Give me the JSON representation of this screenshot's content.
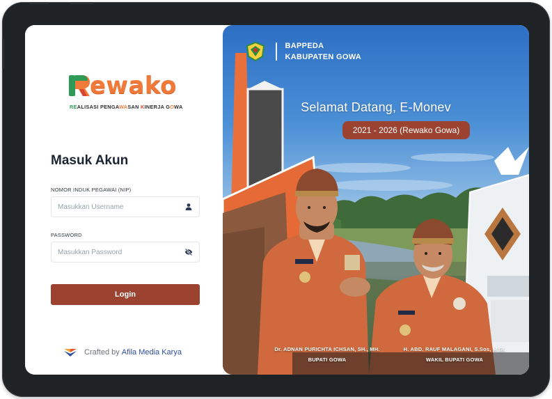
{
  "login": {
    "logo_word": "ewako",
    "logo_tagline": {
      "part1": "RE",
      "part2": "ALISASI PENGA",
      "part3": "WA",
      "part4": "SAN ",
      "part5": "K",
      "part6": "INERJA G",
      "part7": "O",
      "part8": "WA"
    },
    "title": "Masuk Akun",
    "nip_label": "NOMOR INDUK PEGAWAI (NIP)",
    "username_placeholder": "Masukkan Username",
    "password_label": "PASSWORD",
    "password_placeholder": "Masukkan Password",
    "login_button": "Login",
    "credit_prefix": "Crafted by",
    "credit_brand": "Afila Media Karya"
  },
  "hero": {
    "agency_line1": "BAPPEDA",
    "agency_line2": "KABUPATEN GOWA",
    "welcome": "Selamat Datang, E-Monev",
    "period": "2021 - 2026 (Rewako Gowa)",
    "person1_name": "Dr. ADNAN PURICHTA ICHSAN, SH., MH.",
    "person1_title": "BUPATI GOWA",
    "person2_name": "H. ABD. RAUF MALAGANI, S.Sos, M.SI.",
    "person2_title": "WAKIL BUPATI GOWA"
  },
  "colors": {
    "primary": "#9b4231",
    "logo_orange": "#f07a3a",
    "logo_green": "#2e9a55",
    "credit_link": "#2d4e9c",
    "title_text": "#1b2433"
  },
  "icons": {
    "username_field": "user-icon",
    "password_field": "eye-off-icon",
    "credit": "heart-logo-icon",
    "agency": "gowa-emblem-icon"
  }
}
